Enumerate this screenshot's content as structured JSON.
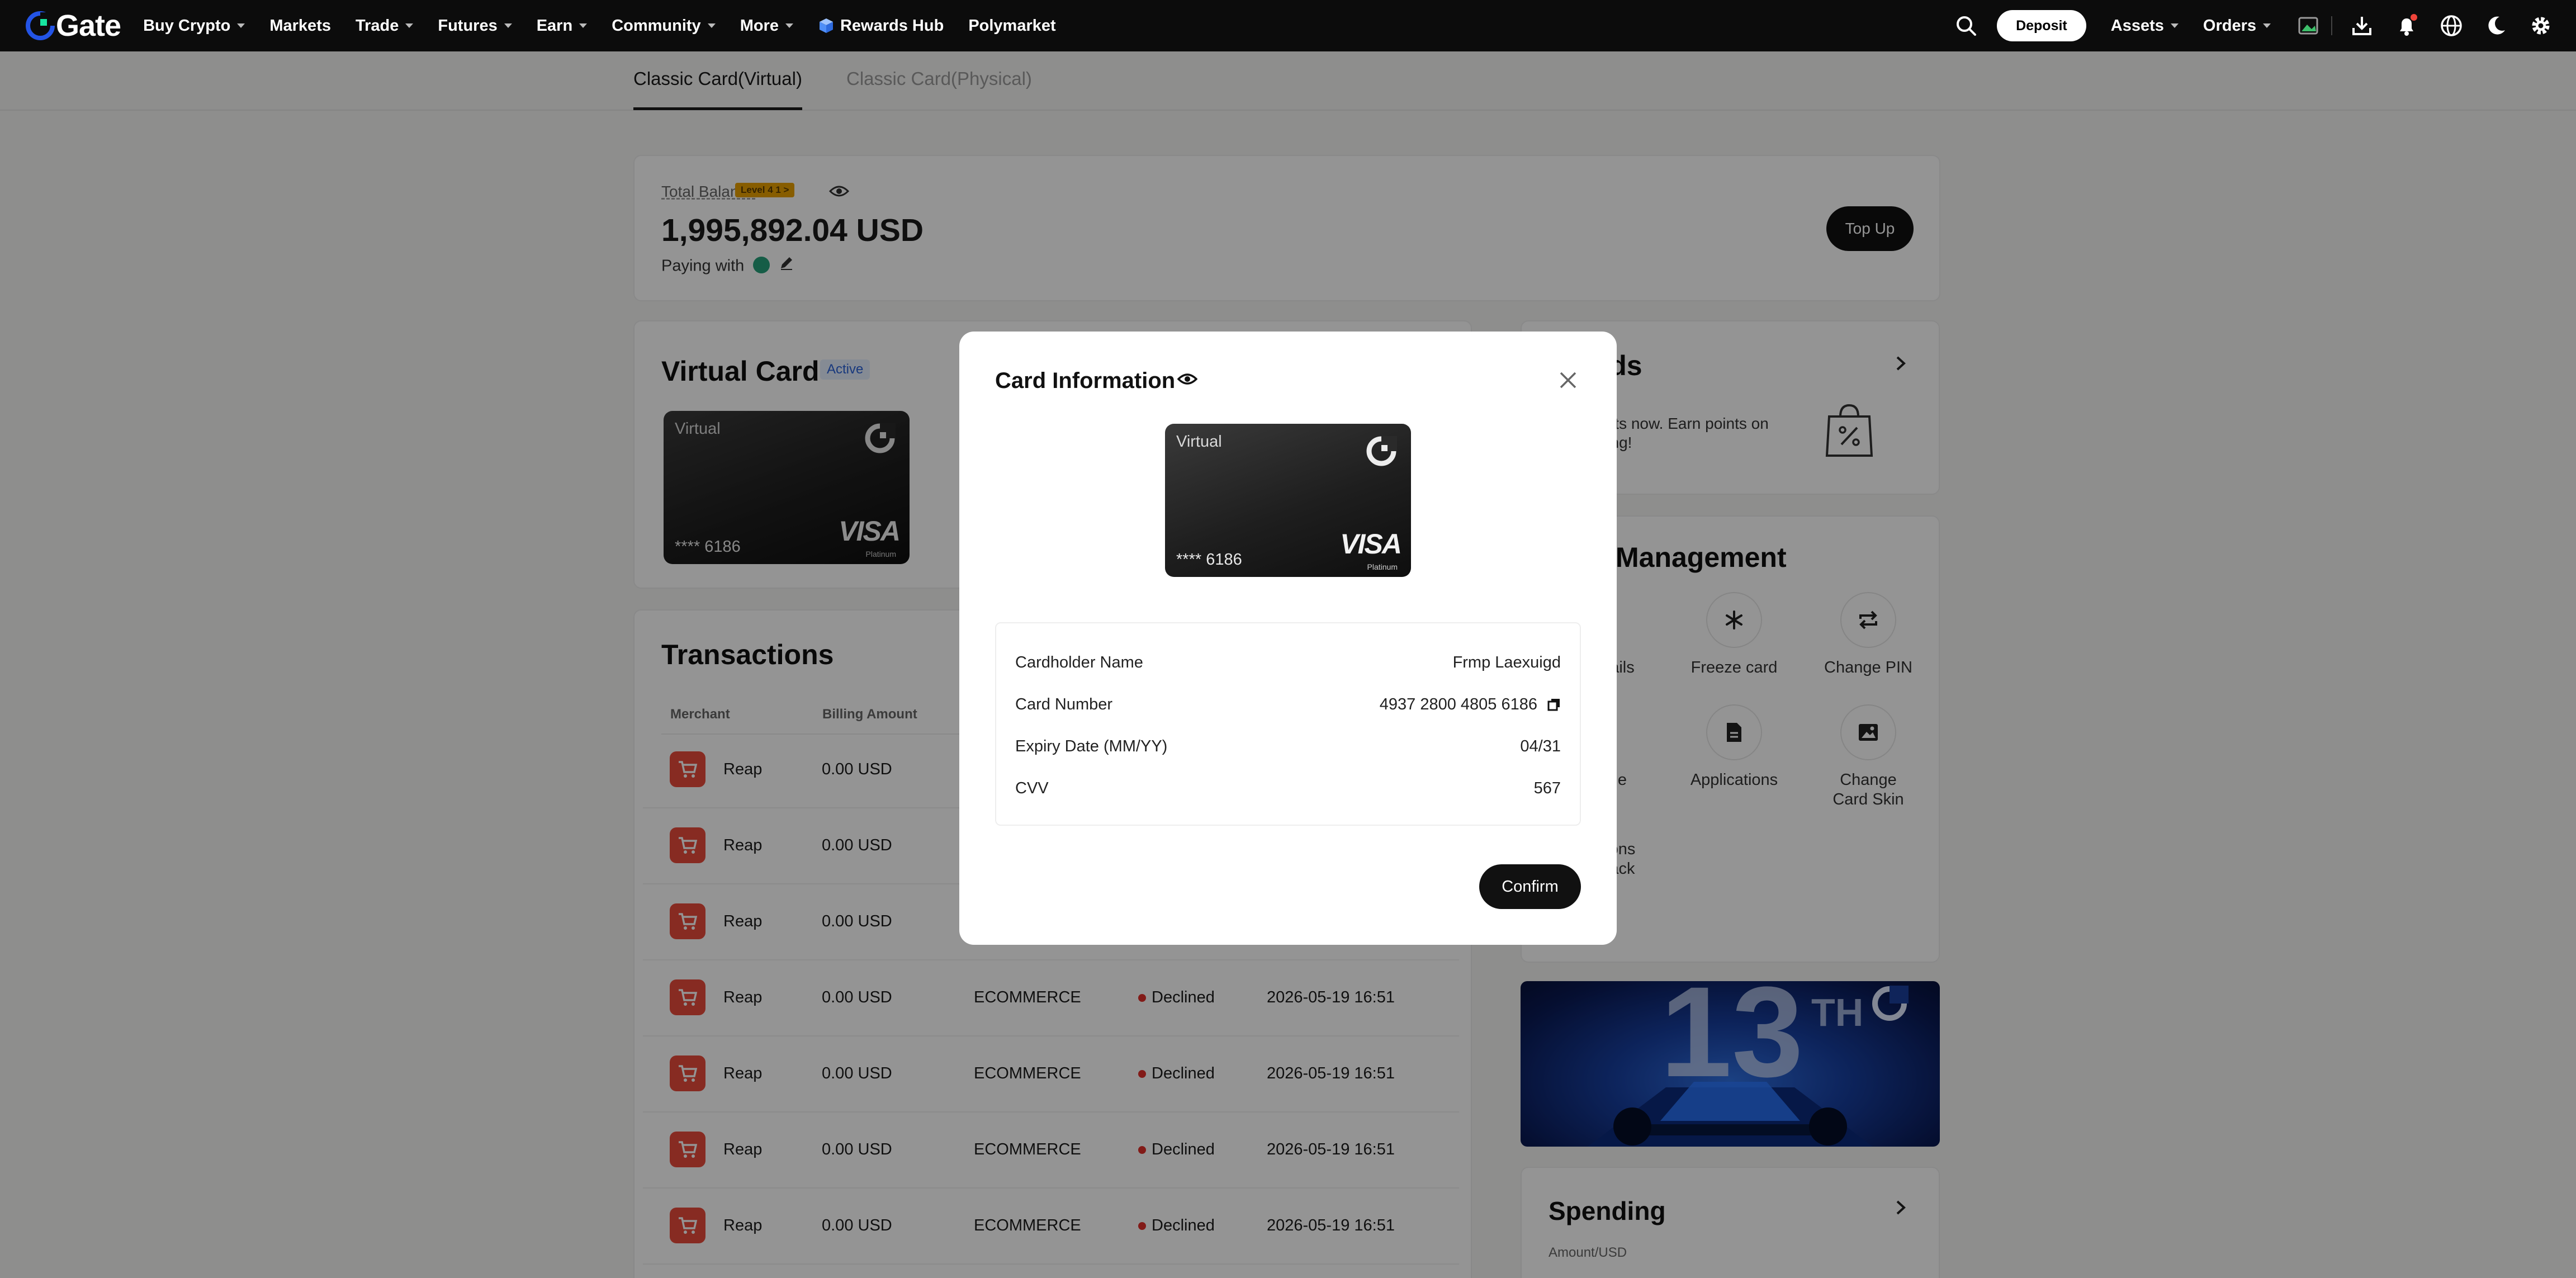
{
  "nav": {
    "logo": "Gate",
    "menu": [
      {
        "label": "Buy Crypto",
        "caret": true
      },
      {
        "label": "Markets",
        "caret": false
      },
      {
        "label": "Trade",
        "caret": true
      },
      {
        "label": "Futures",
        "caret": true
      },
      {
        "label": "Earn",
        "caret": true
      },
      {
        "label": "Community",
        "caret": true
      },
      {
        "label": "More",
        "caret": true
      },
      {
        "label": "Rewards Hub",
        "caret": false
      },
      {
        "label": "Polymarket",
        "caret": false
      }
    ],
    "deposit_label": "Deposit",
    "assets_label": "Assets",
    "orders_label": "Orders"
  },
  "tabs": {
    "virtual": "Classic Card(Virtual)",
    "physical": "Classic Card(Physical)"
  },
  "balance": {
    "label": "Total Balance",
    "level": "Level 4 1 >",
    "value": "1,995,892.04 USD",
    "paying_with": "Paying with",
    "top_up": "Top Up"
  },
  "virtual_card": {
    "title": "Virtual Card",
    "status": "Active",
    "card_label": "Virtual",
    "last4": "**** 6186",
    "brand": "VISA",
    "tier": "Platinum"
  },
  "rewards": {
    "title_partial": "ards",
    "text_line1": "0 points now. Earn points on",
    "text_line2": "pending!"
  },
  "management": {
    "title_partial": "Management",
    "items": {
      "details": "ails",
      "freeze": "Freeze card",
      "change_pin": "Change PIN",
      "partial2": "e",
      "applications": "Applications",
      "change_skin_1": "Change",
      "change_skin_2": "Card Skin",
      "partial3_1": "ons",
      "partial3_2": "ack"
    }
  },
  "spending": {
    "title": "Spending",
    "sub": "Amount/USD"
  },
  "transactions": {
    "title": "Transactions",
    "columns": {
      "merchant": "Merchant",
      "amount": "Billing Amount"
    },
    "rows": [
      {
        "merchant": "Reap",
        "amount": "0.00 USD",
        "type": "",
        "status": "",
        "time": ""
      },
      {
        "merchant": "Reap",
        "amount": "0.00 USD",
        "type": "",
        "status": "",
        "time": ""
      },
      {
        "merchant": "Reap",
        "amount": "0.00 USD",
        "type": "",
        "status": "",
        "time": ""
      },
      {
        "merchant": "Reap",
        "amount": "0.00 USD",
        "type": "ECOMMERCE",
        "status": "Declined",
        "time": "2026-05-19 16:51"
      },
      {
        "merchant": "Reap",
        "amount": "0.00 USD",
        "type": "ECOMMERCE",
        "status": "Declined",
        "time": "2026-05-19 16:51"
      },
      {
        "merchant": "Reap",
        "amount": "0.00 USD",
        "type": "ECOMMERCE",
        "status": "Declined",
        "time": "2026-05-19 16:51"
      },
      {
        "merchant": "Reap",
        "amount": "0.00 USD",
        "type": "ECOMMERCE",
        "status": "Declined",
        "time": "2026-05-19 16:51"
      }
    ]
  },
  "modal": {
    "title": "Card Information",
    "card": {
      "label": "Virtual",
      "last4": "**** 6186",
      "brand": "VISA",
      "tier": "Platinum"
    },
    "fields": [
      {
        "label": "Cardholder Name",
        "value": "Frmp Laexuigd"
      },
      {
        "label": "Card Number",
        "value": "4937 2800 4805 6186"
      },
      {
        "label": "Expiry Date (MM/YY)",
        "value": "04/31"
      },
      {
        "label": "CVV",
        "value": "567"
      }
    ],
    "confirm": "Confirm"
  },
  "colors": {
    "accent_blue": "#2354e6",
    "status_declined": "#e0302a",
    "merchant_icon": "#e84a3c"
  }
}
